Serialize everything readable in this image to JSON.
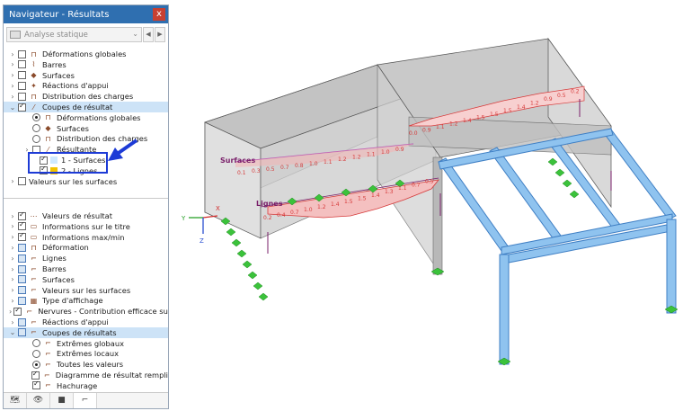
{
  "nav": {
    "title": "Navigateur - Résultats",
    "close_label": "x",
    "combo_value": "Analyse statique",
    "combo_prev": "◀",
    "combo_next": "▶"
  },
  "tree_top": [
    {
      "label": "Déformations globales",
      "checked": false,
      "icon": "deformation-icon"
    },
    {
      "label": "Barres",
      "checked": false,
      "icon": "member-icon"
    },
    {
      "label": "Surfaces",
      "checked": false,
      "icon": "surface-icon"
    },
    {
      "label": "Réactions d'appui",
      "checked": false,
      "icon": "support-reaction-icon"
    },
    {
      "label": "Distribution des charges",
      "checked": false,
      "icon": "load-distribution-icon"
    },
    {
      "label": "Coupes de résultat",
      "checked": true,
      "icon": "result-section-icon"
    },
    {
      "label": "Déformations globales",
      "radio": true,
      "icon": "deformation-icon"
    },
    {
      "label": "Surfaces",
      "radio": false,
      "icon": "surface-icon"
    },
    {
      "label": "Distribution des charges",
      "radio": false,
      "icon": "load-distribution-icon"
    },
    {
      "label": "Résultante",
      "checked": false,
      "icon": "resultant-icon"
    },
    {
      "label": "1 - Surfaces",
      "checked": true,
      "icon": "surface-section-color"
    },
    {
      "label": "2 - Lignes",
      "checked": true,
      "icon": "line-section-color"
    },
    {
      "label": "Valeurs sur les surfaces",
      "checked": false,
      "icon": ""
    }
  ],
  "tree_bottom": [
    {
      "label": "Valeurs de résultat",
      "checked": true,
      "icon": "result-values-icon"
    },
    {
      "label": "Informations sur le titre",
      "checked": true,
      "icon": "title-info-icon"
    },
    {
      "label": "Informations max/min",
      "checked": true,
      "icon": "maxmin-info-icon"
    },
    {
      "label": "Déformation",
      "checked": false,
      "icon": "deformation-icon"
    },
    {
      "label": "Lignes",
      "checked": false,
      "icon": "lines-icon"
    },
    {
      "label": "Barres",
      "checked": false,
      "icon": "members-icon"
    },
    {
      "label": "Surfaces",
      "checked": false,
      "icon": "surfaces-icon"
    },
    {
      "label": "Valeurs sur les surfaces",
      "checked": false,
      "icon": "surface-values-icon"
    },
    {
      "label": "Type d'affichage",
      "checked": false,
      "icon": "display-type-icon"
    },
    {
      "label": "Nervures - Contribution efficace sur la ...",
      "checked": true,
      "icon": "ribs-icon"
    },
    {
      "label": "Réactions d'appui",
      "checked": false,
      "icon": "support-reactions-icon"
    },
    {
      "label": "Coupes de résultats",
      "checked": false,
      "icon": "result-sections-icon"
    },
    {
      "label": "Extrêmes globaux",
      "radio": false,
      "icon": "global-extremes-icon"
    },
    {
      "label": "Extrêmes locaux",
      "radio": false,
      "icon": "local-extremes-icon"
    },
    {
      "label": "Toutes les valeurs",
      "radio": true,
      "icon": "all-values-icon"
    },
    {
      "label": "Diagramme de résultat rempli",
      "checked": true,
      "icon": "filled-diagram-icon"
    },
    {
      "label": "Hachurage",
      "checked": true,
      "icon": "hatching-icon"
    }
  ],
  "model": {
    "label_surfaces": "Surfaces",
    "label_lignes": "Lignes",
    "axis_x": "X",
    "axis_y": "Y",
    "axis_z": "Z",
    "lines_values": [
      "0.2",
      "0.4",
      "0.7",
      "1.0",
      "1.2",
      "1.4",
      "1.5",
      "1.5",
      "1.4",
      "1.3",
      "1.1",
      "0.7",
      "0.5"
    ],
    "surfaces_values": [
      "0.1",
      "0.3",
      "0.5",
      "0.7",
      "0.8",
      "1.0",
      "1.1",
      "1.2",
      "1.2",
      "1.1",
      "1.0",
      "0.9"
    ],
    "right_values": [
      "0.0",
      "0.9",
      "1.1",
      "1.2",
      "1.4",
      "1.5",
      "1.5",
      "1.5",
      "1.4",
      "1.2",
      "0.9",
      "0.5",
      "0.2"
    ],
    "colors": {
      "diagram": "#d63b3b",
      "beam": "#6aa9e6",
      "support": "#3bc23b",
      "label": "#7a1f6a"
    }
  }
}
